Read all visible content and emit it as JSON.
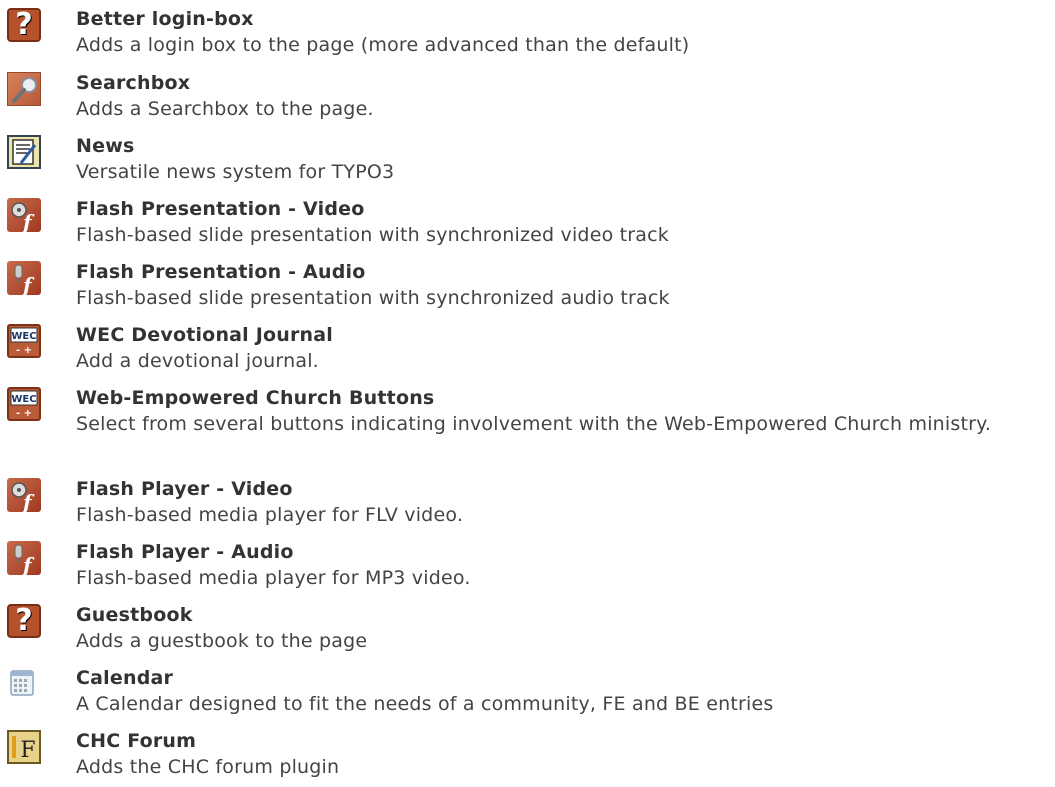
{
  "items": [
    {
      "id": "better-login-box",
      "icon": "question-icon",
      "title": "Better login-box",
      "desc": "Adds a login box to the page (more advanced than the default)"
    },
    {
      "id": "searchbox",
      "icon": "magnifier-icon",
      "title": "Searchbox",
      "desc": "Adds a Searchbox to the page."
    },
    {
      "id": "news",
      "icon": "newspaper-icon",
      "title": "News",
      "desc": "Versatile news system for TYPO3"
    },
    {
      "id": "flash-presentation-video",
      "icon": "flash-film-icon",
      "title": "Flash Presentation - Video",
      "desc": "Flash-based slide presentation with synchronized video track"
    },
    {
      "id": "flash-presentation-audio",
      "icon": "flash-audio-icon",
      "title": "Flash Presentation - Audio",
      "desc": "Flash-based slide presentation with synchronized audio track"
    },
    {
      "id": "wec-devotional-journal",
      "icon": "wec-icon",
      "title": "WEC Devotional Journal",
      "desc": "Add a devotional journal."
    },
    {
      "id": "web-empowered-church-buttons",
      "icon": "wec-icon",
      "title": "Web-Empowered Church Buttons",
      "desc": "Select from several buttons indicating involvement with the Web-Empowered Church ministry."
    },
    {
      "id": "flash-player-video",
      "icon": "flash-film-icon",
      "title": "Flash Player - Video",
      "desc": "Flash-based media player for FLV video."
    },
    {
      "id": "flash-player-audio",
      "icon": "flash-audio-icon",
      "title": "Flash Player - Audio",
      "desc": "Flash-based media player for MP3 video."
    },
    {
      "id": "guestbook",
      "icon": "question-icon",
      "title": "Guestbook",
      "desc": "Adds a guestbook to the page"
    },
    {
      "id": "calendar",
      "icon": "calendar-icon",
      "title": "Calendar",
      "desc": "A Calendar designed to fit the needs of a community, FE and BE entries"
    },
    {
      "id": "chc-forum",
      "icon": "forum-icon",
      "title": "CHC Forum",
      "desc": "Adds the CHC forum plugin"
    }
  ],
  "wec_badge": {
    "top": "WEC",
    "bottom": "- +"
  },
  "forum_letter": "F",
  "question_glyph": "?"
}
